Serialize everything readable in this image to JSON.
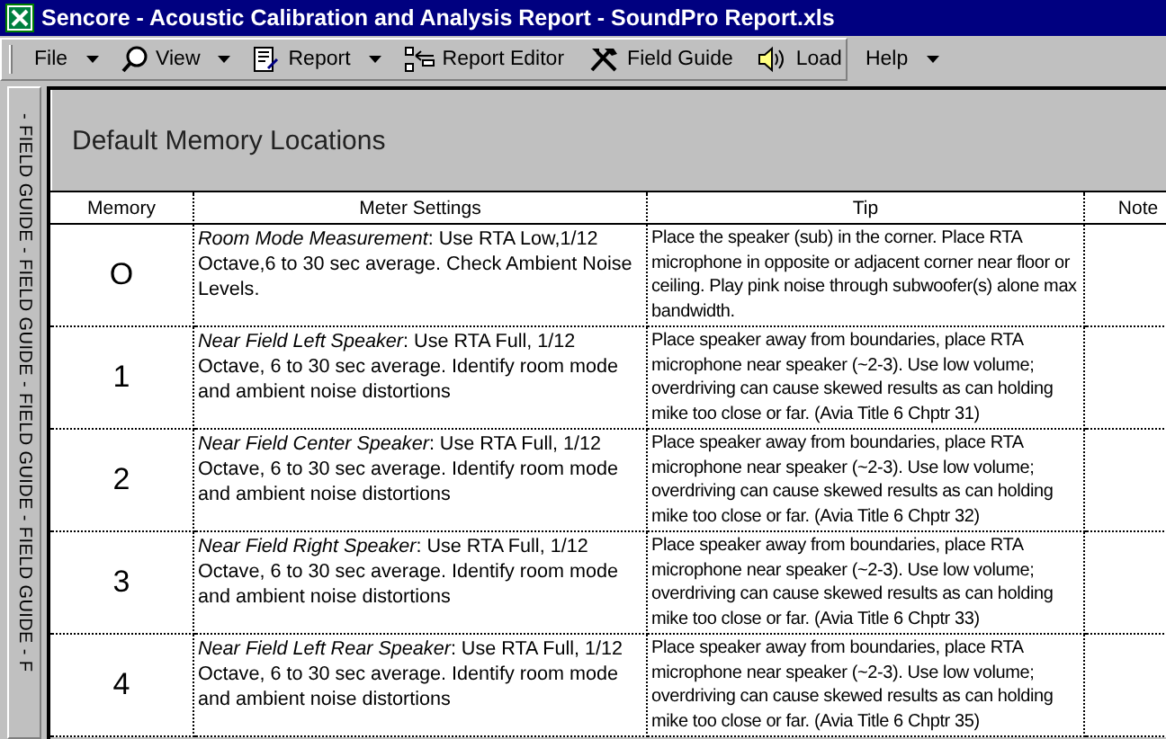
{
  "window": {
    "title": "Sencore - Acoustic Calibration and Analysis Report - SoundPro Report.xls"
  },
  "toolbar": [
    {
      "kind": "menu",
      "label": "File"
    },
    {
      "kind": "menu",
      "label": "View"
    },
    {
      "kind": "menu",
      "label": "Report"
    },
    {
      "kind": "button",
      "label": "Report Editor"
    },
    {
      "kind": "button",
      "label": "Field Guide"
    },
    {
      "kind": "button",
      "label": "Load"
    },
    {
      "kind": "menu",
      "label": "Help"
    }
  ],
  "side_tab": {
    "label": "- FIELD GUIDE - FIELD GUIDE - FIELD GUIDE - FIELD GUIDE - F"
  },
  "sheet": {
    "heading": "Default Memory Locations",
    "table": {
      "columns": [
        "Memory",
        "Meter Settings",
        "Tip",
        "Note"
      ],
      "rows": [
        {
          "memory": "O",
          "settings": "*Room Mode Measurement*: Use RTA Low,1/12 Octave,6 to 30 sec average.  Check Ambient Noise Levels.",
          "tip": "Place the speaker (sub) in the corner.  Place RTA microphone in opposite or adjacent corner near floor or ceiling. Play pink noise through subwoofer(s) alone max bandwidth."
        },
        {
          "memory": "1",
          "settings": "*Near Field Left Speaker*: Use RTA Full, 1/12 Octave, 6 to 30 sec average.  Identify room mode  and ambient noise distortions",
          "tip": "Place speaker away from  boundaries, place RTA microphone near speaker (~2-3).  Use low volume; overdriving can cause skewed results as can holding mike too close or far.  (Avia Title 6 Chptr 31)"
        },
        {
          "memory": "2",
          "settings": "*Near Field Center Speaker*: Use RTA Full, 1/12 Octave, 6 to 30 sec average.  Identify room mode and ambient noise distortions",
          "tip": "Place speaker away from  boundaries, place RTA microphone near speaker (~2-3).  Use low volume; overdriving can cause skewed results as can holding mike too close or far.  (Avia Title 6 Chptr 32)"
        },
        {
          "memory": "3",
          "settings": "*Near Field Right Speaker*: Use RTA Full, 1/12 Octave, 6 to 30 sec average.  Identify room mode and ambient noise distortions",
          "tip": "Place speaker away from  boundaries, place RTA microphone near speaker (~2-3).  Use low volume; overdriving can cause skewed results as can holding mike too close or far.  (Avia Title 6 Chptr 33)"
        },
        {
          "memory": "4",
          "settings": "*Near Field Left Rear Speaker*: Use RTA Full, 1/12 Octave, 6 to 30 sec average.  Identify room mode and ambient noise distortions",
          "tip": "Place speaker away from  boundaries, place RTA microphone near speaker (~2-3).  Use low volume; overdriving can cause skewed results as can holding mike too close or far.  (Avia Title 6 Chptr 35)"
        }
      ]
    }
  }
}
